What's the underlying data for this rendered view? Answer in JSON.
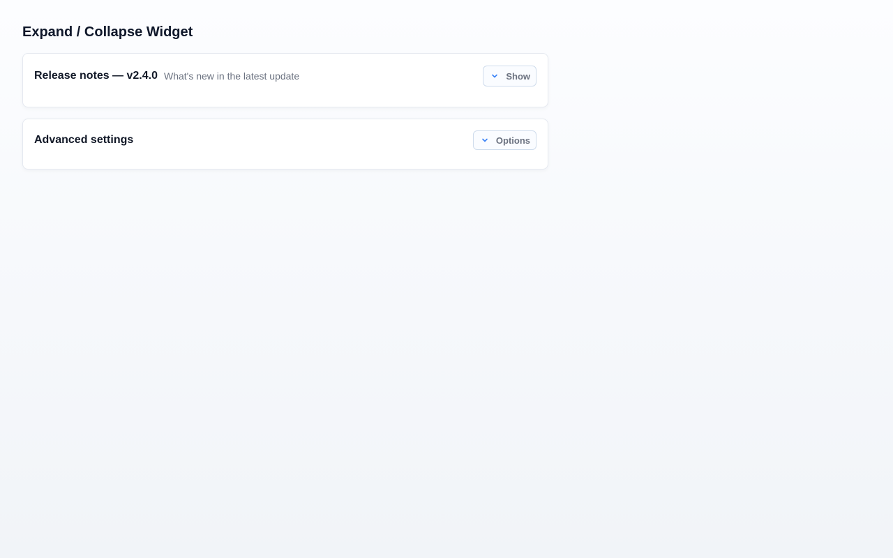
{
  "page": {
    "title": "Expand / Collapse Widget"
  },
  "panels": [
    {
      "title": "Release notes — v2.4.0",
      "subtitle": "What's new in the latest update",
      "toggle_label": "Show",
      "toggle_icon": "chevron-down-icon",
      "expanded": false
    },
    {
      "title": "Advanced settings",
      "toggle_label": "Options",
      "toggle_icon": "chevron-down-icon",
      "expanded": false
    }
  ],
  "colors": {
    "accent": "#3b82f6",
    "title_text": "#0f172a",
    "muted_text": "#6b7280",
    "border": "#e5e9f0"
  }
}
